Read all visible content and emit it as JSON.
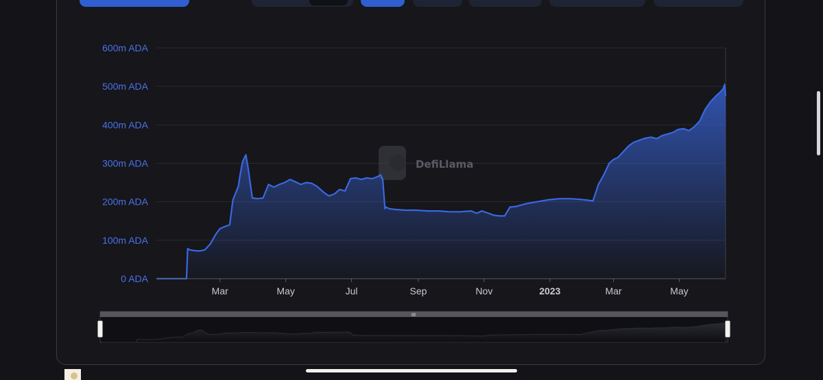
{
  "watermark": "DefiLlama",
  "toolbar": {
    "buttons": [
      {
        "name": "range-button-primary",
        "active": true
      },
      {
        "name": "denomination-toggle",
        "active": false
      },
      {
        "name": "period-button-1",
        "active": true
      },
      {
        "name": "period-button-2",
        "active": false
      },
      {
        "name": "period-button-3",
        "active": false
      },
      {
        "name": "period-button-4",
        "active": false
      },
      {
        "name": "period-button-5",
        "active": false
      }
    ]
  },
  "colors": {
    "background": "#141418",
    "panel": "#16161b",
    "line": "#3a68e0",
    "axis_text": "#4a72e6",
    "x_text": "#c9cbd1",
    "grid": "#2a2b31"
  },
  "chart_data": {
    "type": "area",
    "y_tick_labels": [
      "0 ADA",
      "100m ADA",
      "200m ADA",
      "300m ADA",
      "400m ADA",
      "500m ADA",
      "600m ADA"
    ],
    "y_ticks": [
      0,
      100,
      200,
      300,
      400,
      500,
      600
    ],
    "ylim": [
      0,
      600
    ],
    "y_unit": "m ADA",
    "x_tick_labels": [
      "Mar",
      "May",
      "Jul",
      "Sep",
      "Nov",
      "2023",
      "Mar",
      "May"
    ],
    "x_tick_dates": [
      "2022-03-01",
      "2022-05-01",
      "2022-07-01",
      "2022-09-01",
      "2022-11-01",
      "2023-01-01",
      "2023-03-01",
      "2023-05-01"
    ],
    "x_tick_bold": [
      false,
      false,
      false,
      false,
      false,
      true,
      false,
      false
    ],
    "xlim": [
      "2022-01-01",
      "2023-06-13"
    ],
    "grid": true,
    "series": [
      {
        "x": [
          "2022-01-01",
          "2022-01-15",
          "2022-01-29",
          "2022-01-30",
          "2022-02-01",
          "2022-02-05",
          "2022-02-10",
          "2022-02-15",
          "2022-02-20",
          "2022-02-25",
          "2022-03-01",
          "2022-03-05",
          "2022-03-10",
          "2022-03-13",
          "2022-03-18",
          "2022-03-20",
          "2022-03-22",
          "2022-03-25",
          "2022-03-27",
          "2022-03-31",
          "2022-04-05",
          "2022-04-10",
          "2022-04-15",
          "2022-04-20",
          "2022-04-25",
          "2022-04-30",
          "2022-05-05",
          "2022-05-10",
          "2022-05-15",
          "2022-05-20",
          "2022-05-25",
          "2022-05-30",
          "2022-06-05",
          "2022-06-10",
          "2022-06-15",
          "2022-06-20",
          "2022-06-25",
          "2022-06-30",
          "2022-07-05",
          "2022-07-10",
          "2022-07-15",
          "2022-07-20",
          "2022-07-25",
          "2022-07-28",
          "2022-07-30",
          "2022-08-01",
          "2022-08-02",
          "2022-08-05",
          "2022-08-10",
          "2022-08-20",
          "2022-08-30",
          "2022-09-10",
          "2022-09-20",
          "2022-09-30",
          "2022-10-10",
          "2022-10-20",
          "2022-10-25",
          "2022-10-30",
          "2022-11-05",
          "2022-11-10",
          "2022-11-15",
          "2022-11-20",
          "2022-11-25",
          "2022-12-01",
          "2022-12-10",
          "2022-12-20",
          "2022-12-30",
          "2023-01-10",
          "2023-01-20",
          "2023-01-30",
          "2023-02-05",
          "2023-02-10",
          "2023-02-15",
          "2023-02-20",
          "2023-02-25",
          "2023-03-01",
          "2023-03-05",
          "2023-03-10",
          "2023-03-15",
          "2023-03-20",
          "2023-03-25",
          "2023-03-30",
          "2023-04-05",
          "2023-04-10",
          "2023-04-15",
          "2023-04-20",
          "2023-04-25",
          "2023-04-30",
          "2023-05-05",
          "2023-05-10",
          "2023-05-15",
          "2023-05-20",
          "2023-05-25",
          "2023-05-30",
          "2023-06-04",
          "2023-06-08",
          "2023-06-11",
          "2023-06-12",
          "2023-06-13"
        ],
        "y": [
          0,
          0,
          0,
          78,
          75,
          73,
          72,
          75,
          90,
          115,
          130,
          135,
          140,
          205,
          240,
          275,
          305,
          322,
          290,
          210,
          208,
          210,
          245,
          238,
          245,
          250,
          258,
          252,
          245,
          250,
          248,
          240,
          225,
          215,
          220,
          232,
          228,
          260,
          262,
          258,
          262,
          260,
          265,
          270,
          258,
          182,
          186,
          182,
          180,
          178,
          178,
          176,
          176,
          174,
          174,
          176,
          170,
          176,
          170,
          165,
          163,
          163,
          186,
          188,
          195,
          200,
          205,
          208,
          208,
          206,
          204,
          202,
          245,
          270,
          300,
          310,
          315,
          330,
          345,
          355,
          360,
          365,
          368,
          364,
          372,
          376,
          380,
          388,
          390,
          385,
          395,
          410,
          440,
          460,
          475,
          485,
          495,
          505,
          475
        ]
      }
    ]
  }
}
